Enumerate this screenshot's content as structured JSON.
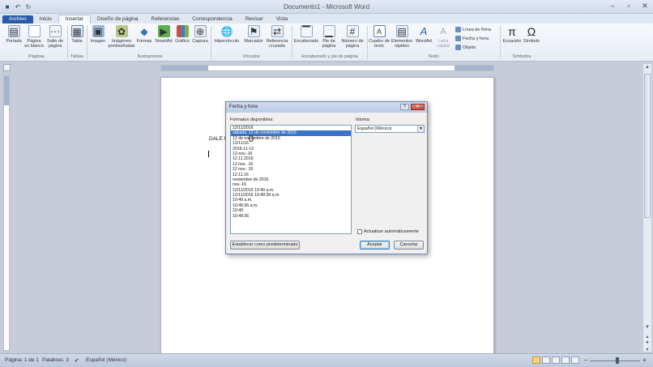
{
  "window": {
    "title": "Documento1 - Microsoft Word",
    "qat": [
      "save-icon",
      "undo-icon",
      "redo-icon"
    ]
  },
  "tabs": [
    "Archivo",
    "Inicio",
    "Insertar",
    "Diseño de página",
    "Referencias",
    "Correspondencia",
    "Revisar",
    "Vista"
  ],
  "ribbon": {
    "buttons": [
      {
        "label": "Portada",
        "icon": "cover-page-icon"
      },
      {
        "label": "Página en blanco",
        "icon": "blank-page-icon"
      },
      {
        "label": "Salto de página",
        "icon": "page-break-icon"
      },
      {
        "label": "Tabla",
        "icon": "table-icon"
      },
      {
        "label": "Imagen",
        "icon": "picture-icon"
      },
      {
        "label": "Imágenes prediseñadas",
        "icon": "clipart-icon"
      },
      {
        "label": "Formas",
        "icon": "shapes-icon"
      },
      {
        "label": "SmartArt",
        "icon": "smartart-icon"
      },
      {
        "label": "Gráfico",
        "icon": "chart-icon"
      },
      {
        "label": "Captura",
        "icon": "screenshot-icon"
      },
      {
        "label": "Hipervínculo",
        "icon": "hyperlink-icon"
      },
      {
        "label": "Marcador",
        "icon": "bookmark-icon"
      },
      {
        "label": "Referencia cruzada",
        "icon": "cross-reference-icon"
      },
      {
        "label": "Encabezado",
        "icon": "header-icon"
      },
      {
        "label": "Pie de página",
        "icon": "footer-icon"
      },
      {
        "label": "Número de página",
        "icon": "page-number-icon"
      },
      {
        "label": "Cuadro de texto",
        "icon": "textbox-icon"
      },
      {
        "label": "Elementos rápidos",
        "icon": "quick-parts-icon"
      },
      {
        "label": "WordArt",
        "icon": "wordart-icon"
      },
      {
        "label": "Letra capital",
        "icon": "drop-cap-icon"
      },
      {
        "label": "Ecuación",
        "icon": "equation-icon"
      },
      {
        "label": "Símbolo",
        "icon": "symbol-icon"
      }
    ],
    "small_buttons": [
      "Línea de firma",
      "Fecha y hora",
      "Objeto"
    ],
    "groups": [
      "Páginas",
      "Tablas",
      "Ilustraciones",
      "Vínculos",
      "Encabezado y pie de página",
      "Texto",
      "Símbolos"
    ]
  },
  "document": {
    "text": "DALE U"
  },
  "dialog": {
    "title": "Fecha y hora",
    "formats_label": "Formatos disponibles:",
    "language_label": "Idioma:",
    "language_value": "Español (México)",
    "formats": [
      "12/11/2016",
      "sábado, 12 de noviembre de 2016",
      "12 de noviembre de 2016",
      "12/11/16",
      "2016-11-12",
      "12-nov.-16",
      "12.11.2016",
      "12 nov.. 16",
      "12 nov.. 16",
      "12.11.16",
      "noviembre de 2016",
      "nov.-16",
      "12/11/2016 10:49 a.m.",
      "12/11/2016 10:49:36 a.m.",
      "10:49 a.m.",
      "10:49:36 a.m.",
      "10:49",
      "10:49:36"
    ],
    "selected_index": 1,
    "auto_update_label": "Actualizar automáticamente",
    "default_button": "Establecer como predeterminado",
    "ok_button": "Aceptar",
    "cancel_button": "Cancelar"
  },
  "status": {
    "page": "Página: 1 de 1",
    "words": "Palabras: 3",
    "language": "Español (México)"
  }
}
